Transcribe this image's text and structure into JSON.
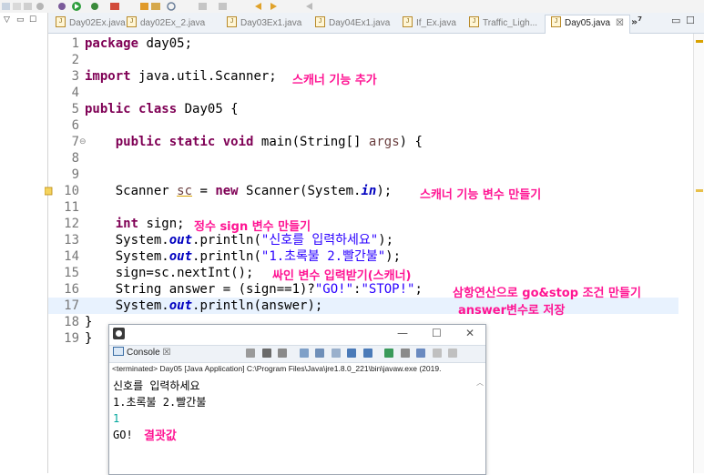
{
  "toolbar": {
    "icons": [
      "skip-icon",
      "debug-run-icon",
      "run-icon",
      "coverage-icon",
      "external-tools-icon",
      "new-java-project-icon",
      "open-folder-icon",
      "search-icon",
      "next-annotation-icon",
      "previous-annotation-icon",
      "back-icon",
      "forward-icon"
    ]
  },
  "tabs": [
    {
      "label": "Day02Ex.java"
    },
    {
      "label": "day02Ex_2.java"
    },
    {
      "label": "Day03Ex1.java"
    },
    {
      "label": "Day04Ex1.java"
    },
    {
      "label": "If_Ex.java"
    },
    {
      "label": "Traffic_Ligh..."
    },
    {
      "label": "Day05.java",
      "active": true,
      "close": "☒"
    }
  ],
  "tab_overflow": "»",
  "tab_overflow_count": "7",
  "editor": {
    "line_numbers": [
      "1",
      "2",
      "3",
      "4",
      "5",
      "6",
      "7",
      "8",
      "9",
      "10",
      "11",
      "12",
      "13",
      "14",
      "15",
      "16",
      "17",
      "18",
      "19"
    ],
    "code": {
      "l1": {
        "kw": "package",
        "rest": " day05;"
      },
      "l3": {
        "kw": "import",
        "rest": " java.util.Scanner;"
      },
      "l5": {
        "kw1": "public",
        "kw2": "class",
        "rest": " Day05 {"
      },
      "l7": {
        "kw1": "public",
        "kw2": "static",
        "kw3": "void",
        "mid": " main(String[] ",
        "arg": "args",
        "end": ") {"
      },
      "l10": {
        "pre": "Scanner ",
        "var": "sc",
        "mid": " = ",
        "kw": "new",
        "mid2": " Scanner(System.",
        "fld": "in",
        "end": ");"
      },
      "l12": {
        "kw": "int",
        "rest": " sign;"
      },
      "l13": {
        "pre": "System.",
        "fld": "out",
        "mid": ".println(",
        "str": "\"신호를 입력하세요\"",
        "end": ");"
      },
      "l14": {
        "pre": "System.",
        "fld": "out",
        "mid": ".println(",
        "str": "\"1.초록불 2.빨간불\"",
        "end": ");"
      },
      "l15": {
        "text": "sign=sc.nextInt();"
      },
      "l16": {
        "pre": "String answer = (sign==1)?",
        "str1": "\"GO!\"",
        "colon": ":",
        "str2": "\"STOP!\"",
        "end": ";"
      },
      "l17": {
        "pre": "System.",
        "fld": "out",
        "end": ".println(answer);"
      },
      "l18": {
        "text": "}"
      },
      "l19": {
        "text": "}"
      }
    },
    "annotations": {
      "scanner_add": "스캐너 기능 추가",
      "scanner_var": "스캐너 기능 변수 만들기",
      "sign_var": "정수 sign 변수 만들기",
      "sign_input": "싸인 변수 입력받기(스캐너)",
      "ternary_1": "삼항연산으로 go&stop 조건 만들기",
      "ternary_2": "answer변수로 저장"
    }
  },
  "console": {
    "tab_label": "Console",
    "tab_close": "☒",
    "terminated": "<terminated> Day05 [Java Application] C:\\Program Files\\Java\\jre1.8.0_221\\bin\\javaw.exe (2019.",
    "output": [
      "신호를 입력하세요",
      "1.초록불 2.빨간불",
      "1",
      "GO!"
    ],
    "result_note": "결괏값",
    "window_buttons": {
      "minimize": "—",
      "maximize": "☐",
      "close": "✕"
    }
  },
  "colors": {
    "keyword": "#7f0055",
    "string": "#2a00ff",
    "field": "#0000c0",
    "annotation": "#ff1493",
    "input_echo": "#00a69c",
    "current_line": "#e8f2fe"
  }
}
